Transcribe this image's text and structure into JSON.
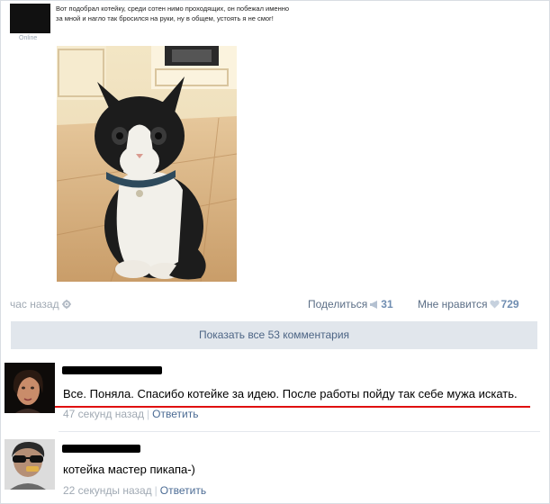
{
  "post": {
    "online_label": "Online",
    "text": "Вот подобрал котейку, среди сотен нимо проходящих, он побежал именно за мной и нагло так бросился на руки, ну в общем, устоять я не смог!",
    "time": "час назад",
    "share_label": "Поделиться",
    "share_count": "31",
    "like_label": "Мне нравится",
    "like_count": "729"
  },
  "comments_button": "Показать все 53 комментария",
  "comments": [
    {
      "text": "Все. Поняла. Спасибо котейке за идею. После работы пойду так себе мужа искать.",
      "time": "47 секунд назад",
      "reply": "Ответить"
    },
    {
      "text": "котейка мастер пикапа-)",
      "time": "22 секунды назад",
      "reply": "Ответить"
    }
  ],
  "colors": {
    "link": "#4b6b94",
    "muted": "#a0a9b3",
    "button_bg": "#e1e6ec",
    "highlight_underline": "#e01010"
  },
  "icons": [
    "gear-icon",
    "megaphone-icon",
    "heart-icon"
  ]
}
